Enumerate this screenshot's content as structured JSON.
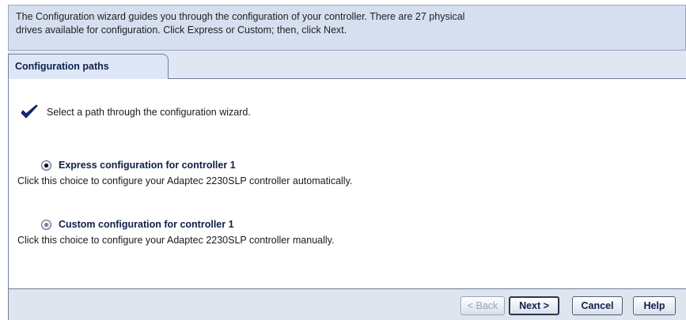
{
  "intro": {
    "line1": "The Configuration wizard guides you through the configuration of your controller. There are 27 physical",
    "line2": "drives available for configuration. Click Express or Custom; then, click Next."
  },
  "tabs": [
    {
      "label": "Configuration paths"
    }
  ],
  "prompt": {
    "icon": "checkmark-icon",
    "text": "Select a path through the configuration wizard."
  },
  "options": [
    {
      "title": "Express configuration for controller 1",
      "description": "Click this choice to configure your Adaptec 2230SLP controller automatically.",
      "selected": true
    },
    {
      "title": "Custom configuration for controller 1",
      "description": "Click this choice to configure your Adaptec 2230SLP controller manually.",
      "selected": false
    }
  ],
  "buttons": {
    "back": "< Back",
    "next": "Next >",
    "cancel": "Cancel",
    "help": "Help"
  },
  "colors": {
    "intro_bg": "#d6dff0",
    "footer_bg": "#dfe5ee",
    "accent": "#10204a"
  }
}
